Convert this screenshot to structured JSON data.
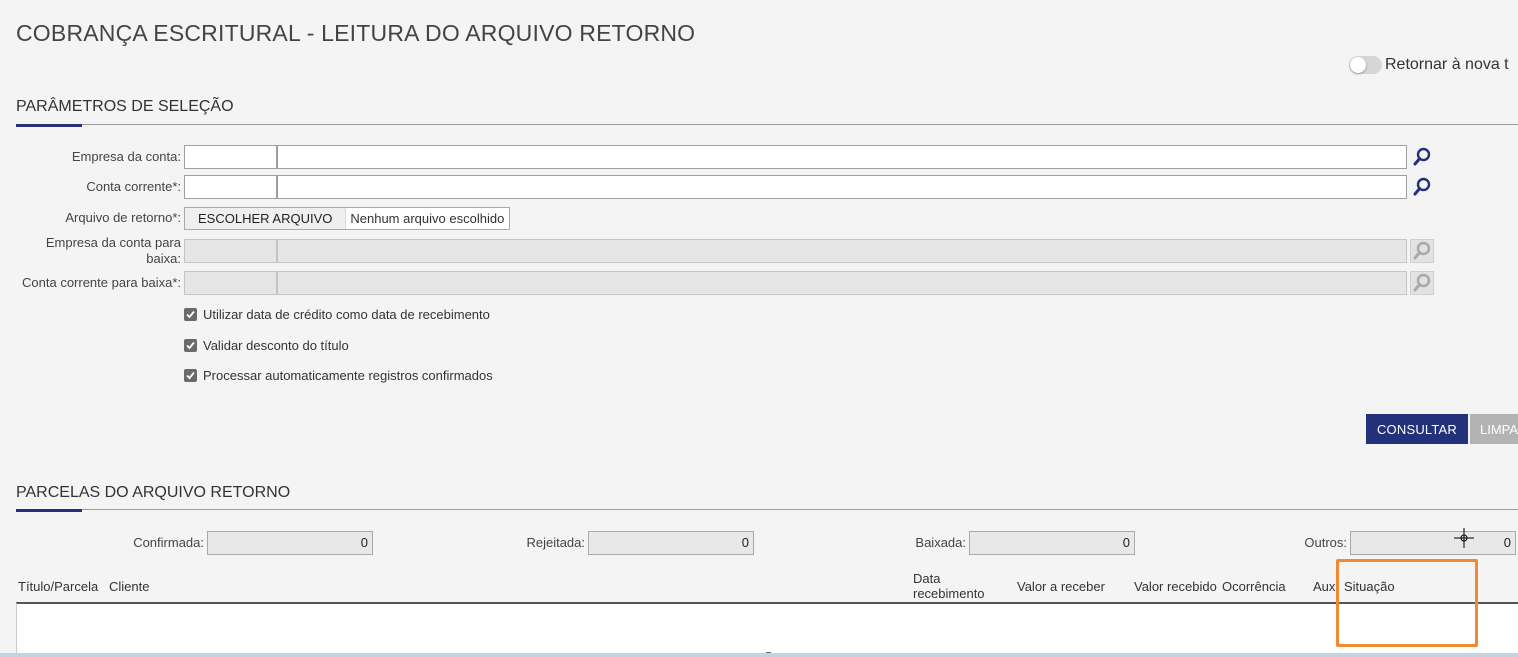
{
  "page": {
    "title": "COBRANÇA ESCRITURAL - LEITURA DO ARQUIVO RETORNO",
    "toggle_label": "Retornar à nova t"
  },
  "selection": {
    "section_title": "PARÂMETROS DE SELEÇÃO",
    "empresa_conta_label": "Empresa da conta:",
    "conta_corrente_label": "Conta corrente*:",
    "arquivo_retorno_label": "Arquivo de retorno*:",
    "file_button_label": "ESCOLHER ARQUIVO",
    "file_status": "Nenhum arquivo escolhido",
    "empresa_baixa_label_1": "Empresa da conta para",
    "empresa_baixa_label_2": "baixa:",
    "conta_baixa_label": "Conta corrente para baixa*:",
    "options": [
      {
        "label": "Utilizar data de crédito como data de recebimento",
        "checked": true
      },
      {
        "label": "Validar desconto do título",
        "checked": true
      },
      {
        "label": "Processar automaticamente registros confirmados",
        "checked": true
      }
    ],
    "consultar_label": "CONSULTAR",
    "limpar_label": "LIMPA"
  },
  "parcelas": {
    "section_title": "PARCELAS DO ARQUIVO RETORNO",
    "counters": [
      {
        "label": "Confirmada:",
        "value": "0"
      },
      {
        "label": "Rejeitada:",
        "value": "0"
      },
      {
        "label": "Baixada:",
        "value": "0"
      },
      {
        "label": "Outros:",
        "value": "0"
      }
    ],
    "columns": {
      "titulo": "Título/Parcela",
      "cliente": "Cliente",
      "data_1": "Data",
      "data_2": "recebimento",
      "valor_receber": "Valor a receber",
      "valor_recebido": "Valor recebido",
      "ocorrencia": "Ocorrência",
      "aux": "Aux",
      "situacao": "Situação"
    }
  },
  "colors": {
    "primary": "#22317a",
    "highlight": "#f08a33",
    "background": "#f4f4f4"
  },
  "icons": {
    "lookup": "search-icon",
    "checkbox": "check-icon"
  }
}
